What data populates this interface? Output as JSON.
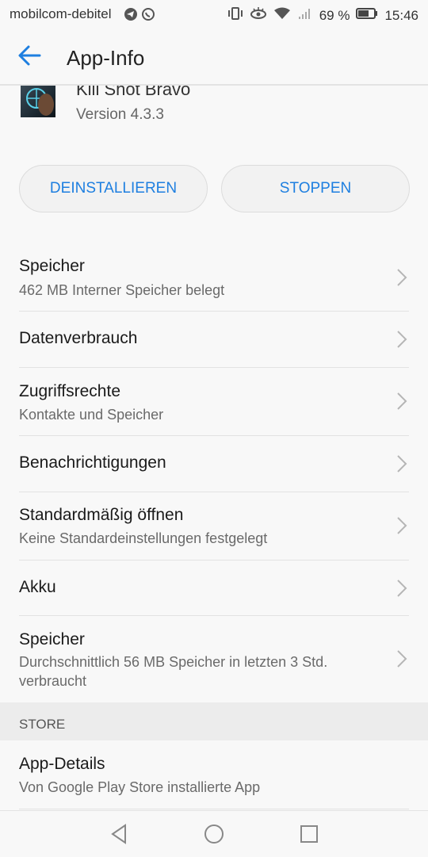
{
  "status_bar": {
    "carrier": "mobilcom-debitel",
    "battery": "69 %",
    "time": "15:46",
    "icons": [
      "telegram-icon",
      "whatsapp-icon",
      "vibrate-icon",
      "eye-icon",
      "wifi-icon",
      "signal-icon",
      "battery-icon"
    ]
  },
  "app_bar": {
    "title": "App-Info"
  },
  "app": {
    "name": "Kill Shot Bravo",
    "version": "Version 4.3.3"
  },
  "buttons": {
    "uninstall": "DEINSTALLIEREN",
    "stop": "STOPPEN"
  },
  "settings": [
    {
      "title": "Speicher",
      "subtitle": "462 MB Interner Speicher belegt"
    },
    {
      "title": "Datenverbrauch",
      "subtitle": ""
    },
    {
      "title": "Zugriffsrechte",
      "subtitle": "Kontakte und Speicher"
    },
    {
      "title": "Benachrichtigungen",
      "subtitle": ""
    },
    {
      "title": "Standardmäßig öffnen",
      "subtitle": "Keine Standardeinstellungen festgelegt"
    },
    {
      "title": "Akku",
      "subtitle": ""
    },
    {
      "title": "Speicher",
      "subtitle": "Durchschnittlich 56 MB Speicher in letzten 3 Std. verbraucht"
    }
  ],
  "store_section": {
    "header": "STORE"
  },
  "store_items": [
    {
      "title": "App-Details",
      "subtitle": "Von Google Play Store installierte App"
    }
  ],
  "accent_color": "#1e7fe0"
}
